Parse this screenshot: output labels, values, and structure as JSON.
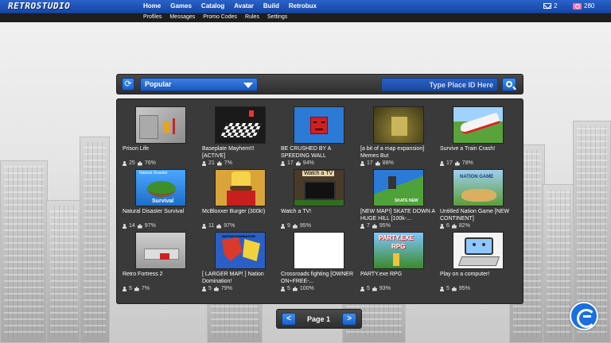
{
  "brand": {
    "logo_text": "RETROSTUDIO"
  },
  "nav": {
    "main": [
      "Home",
      "Games",
      "Catalog",
      "Avatar",
      "Build",
      "Retrobux"
    ],
    "sub": [
      "Profiles",
      "Messages",
      "Promo Codes",
      "Rules",
      "Settings"
    ],
    "messages_count": "2",
    "robux_count": "280"
  },
  "search": {
    "sort_selected": "Popular",
    "place_placeholder": "Type Place ID Here"
  },
  "games": [
    {
      "name": "Prison Life",
      "players": "25",
      "rating": "76%"
    },
    {
      "name": "Baseplate Mayhem!!! [ACTIVE]",
      "players": "21",
      "rating": "7%"
    },
    {
      "name": "BE CRUSHED BY A SPEEDING WALL",
      "players": "17",
      "rating": "94%"
    },
    {
      "name": "[a bit of a map expansion] Memes But",
      "players": "17",
      "rating": "88%"
    },
    {
      "name": "Survive a Train Crash!",
      "players": "17",
      "rating": "78%"
    },
    {
      "name": "Natural Disaster Survival",
      "players": "14",
      "rating": "97%",
      "thumb_text_top": "Natural Disaster",
      "thumb_text_bottom": "Survival"
    },
    {
      "name": "McBloxxer Burger (300k!)",
      "players": "11",
      "rating": "97%"
    },
    {
      "name": "Watch a TV!",
      "players": "9",
      "rating": "95%",
      "thumb_text_top": "Watch a TV"
    },
    {
      "name": "[NEW MAP!] SKATE DOWN A HUGE HILL [100k-...",
      "players": "7",
      "rating": "95%",
      "thumb_text_bottom": "SKATE NEW"
    },
    {
      "name": "Untitled Nation Game [NEW CONTINENT]",
      "players": "6",
      "rating": "82%",
      "thumb_text_top": "NATION GAME"
    },
    {
      "name": "Retro Fortress 2",
      "players": "5",
      "rating": "7%"
    },
    {
      "name": "[ LARGER MAP! ] Nation Domination!",
      "players": "5",
      "rating": "79%",
      "thumb_text_top": "NATION DOMINATION"
    },
    {
      "name": "Crossroads fighting [OWNER ON+FREE-...",
      "players": "5",
      "rating": "100%"
    },
    {
      "name": "PARTY.exe RPG",
      "players": "5",
      "rating": "93%",
      "thumb_text_top": "PARTY.EXE",
      "thumb_text_bottom": "RPG"
    },
    {
      "name": "Play on a computer!",
      "players": "5",
      "rating": "95%"
    }
  ],
  "pager": {
    "label": "Page 1",
    "prev": "<",
    "next": ">"
  },
  "colors": {
    "nav_blue": "#1e56b8",
    "button_blue": "#2a74dc",
    "panel": "#3a3a3a"
  }
}
